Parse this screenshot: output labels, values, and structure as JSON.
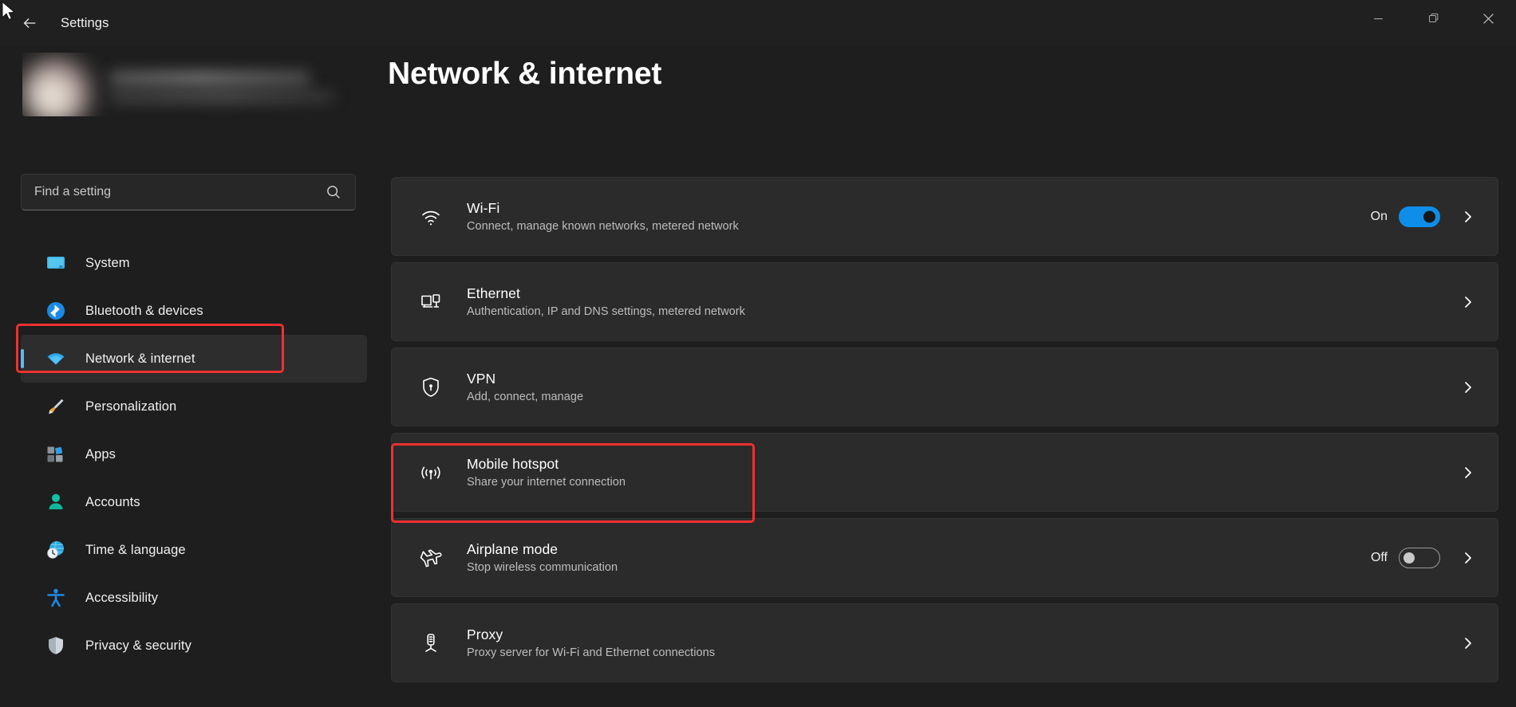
{
  "window": {
    "app_title": "Settings",
    "back_icon": "back-arrow-icon",
    "controls": {
      "minimize": "minimize-icon",
      "restore": "restore-icon",
      "close": "close-icon"
    }
  },
  "sidebar": {
    "profile": {
      "redacted": true,
      "avatar": "user-avatar"
    },
    "search": {
      "placeholder": "Find a setting",
      "value": "",
      "icon": "search-icon"
    },
    "items": [
      {
        "label": "System",
        "icon": "system-icon",
        "selected": false
      },
      {
        "label": "Bluetooth & devices",
        "icon": "bluetooth-icon",
        "selected": false
      },
      {
        "label": "Network & internet",
        "icon": "wifi-icon",
        "selected": true
      },
      {
        "label": "Personalization",
        "icon": "paintbrush-icon",
        "selected": false
      },
      {
        "label": "Apps",
        "icon": "apps-icon",
        "selected": false
      },
      {
        "label": "Accounts",
        "icon": "accounts-icon",
        "selected": false
      },
      {
        "label": "Time & language",
        "icon": "clock-globe-icon",
        "selected": false
      },
      {
        "label": "Accessibility",
        "icon": "accessibility-icon",
        "selected": false
      },
      {
        "label": "Privacy & security",
        "icon": "shield-icon",
        "selected": false
      }
    ]
  },
  "main": {
    "page_title": "Network & internet",
    "rows": [
      {
        "title": "Wi-Fi",
        "subtitle": "Connect, manage known networks, metered network",
        "icon": "wifi-signal-icon",
        "state_label": "On",
        "toggle": "on",
        "chevron": "chevron-right-icon"
      },
      {
        "title": "Ethernet",
        "subtitle": "Authentication, IP and DNS settings, metered network",
        "icon": "ethernet-icon",
        "state_label": "",
        "toggle": "none",
        "chevron": "chevron-right-icon"
      },
      {
        "title": "VPN",
        "subtitle": "Add, connect, manage",
        "icon": "vpn-shield-icon",
        "state_label": "",
        "toggle": "none",
        "chevron": "chevron-right-icon"
      },
      {
        "title": "Mobile hotspot",
        "subtitle": "Share your internet connection",
        "icon": "hotspot-icon",
        "state_label": "",
        "toggle": "none",
        "chevron": "chevron-right-icon"
      },
      {
        "title": "Airplane mode",
        "subtitle": "Stop wireless communication",
        "icon": "airplane-icon",
        "state_label": "Off",
        "toggle": "off",
        "chevron": "chevron-right-icon"
      },
      {
        "title": "Proxy",
        "subtitle": "Proxy server for Wi-Fi and Ethernet connections",
        "icon": "proxy-icon",
        "state_label": "",
        "toggle": "none",
        "chevron": "chevron-right-icon"
      }
    ]
  },
  "annotations": {
    "color": "#f03030",
    "targets": [
      "Network & internet",
      "Mobile hotspot"
    ]
  },
  "colors": {
    "page_background": "#1e1e1e",
    "card_background": "#2b2b2b",
    "accent": "#4cc2ff",
    "toggle_on": "#0e8ee9",
    "annotation": "#f03030"
  }
}
